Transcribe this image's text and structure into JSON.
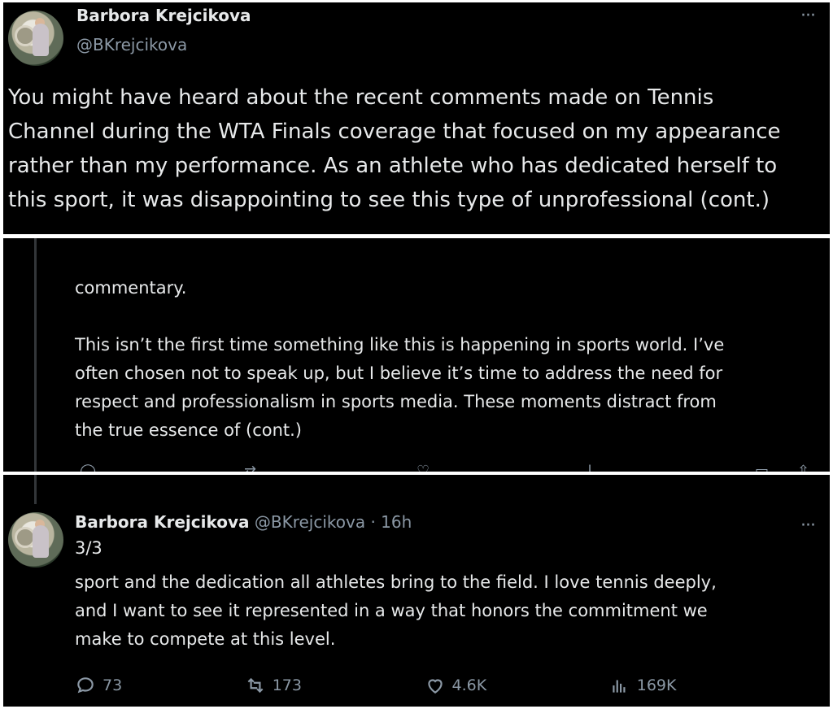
{
  "tweet1": {
    "name": "Barbora Krejcikova",
    "handle": "@BKrejcikova",
    "more": "···",
    "text": "You might have heard about the recent comments made on Tennis\nChannel during the WTA Finals coverage that focused on my appearance\nrather than my performance. As an athlete who has dedicated herself to\nthis sport, it was disappointing to see this type of unprofessional (cont.)"
  },
  "tweet2": {
    "text": "commentary.\n\nThis isn’t the first time something like this is happening in sports world. I’ve\noften chosen not to speak up, but I believe it’s time to address the need for\nrespect and professionalism in sports media. These moments distract from\nthe true essence of (cont.)"
  },
  "tweet3": {
    "name": "Barbora Krejcikova",
    "handle_time": "@BKrejcikova · 16h",
    "more": "···",
    "count": "3/3",
    "text": "sport and the dedication all athletes bring to the field. I love tennis deeply,\nand I want to see it represented in a way that honors the commitment we\nmake to compete at this level.",
    "actions": {
      "replies": "73",
      "reposts": "173",
      "likes": "4.6K",
      "views": "169K"
    },
    "icons": [
      "reply-icon",
      "repost-icon",
      "like-icon",
      "views-icon",
      "bookmark-icon",
      "share-icon"
    ]
  },
  "colors": {
    "background": "#000000",
    "text": "#e7e9ea",
    "secondary": "#8b98a5",
    "divider": "#ffffff"
  }
}
